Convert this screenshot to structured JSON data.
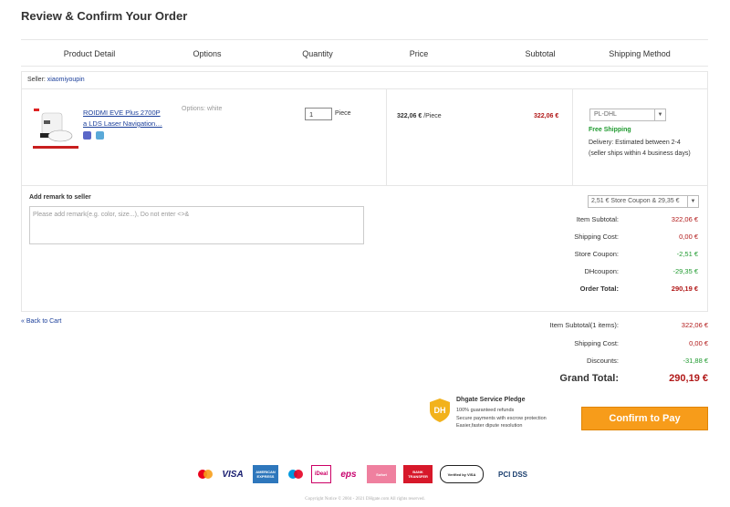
{
  "page_title": "Review & Confirm Your Order",
  "columns": [
    "Product Detail",
    "Options",
    "Quantity",
    "Price",
    "Subtotal",
    "Shipping Method"
  ],
  "seller": {
    "label": "Seller:",
    "name": "xiaomiyoupin"
  },
  "product": {
    "title": "ROIDMI EVE Plus 2700P a LDS Laser Navigation…",
    "options": "Options:  white",
    "quantity": "1",
    "unit": "Piece",
    "price": "322,06 €",
    "price_unit": "/Piece",
    "subtotal": "322,06 €",
    "shipping_method": "PL-DHL",
    "free_shipping": "Free Shipping",
    "delivery": "Delivery: Estimated between 2-4 (seller ships within 4 business days)"
  },
  "remark": {
    "label": "Add remark to seller",
    "placeholder": "Please add remark(e.g. color, size...), Do not enter <>&"
  },
  "coupon_select": "2,51 € Store Coupon & 29,35 €",
  "store_totals": [
    {
      "label": "Item Subtotal:",
      "value": "322,06 €",
      "tone": "red"
    },
    {
      "label": "Shipping Cost:",
      "value": "0,00 €",
      "tone": "red"
    },
    {
      "label": "Store Coupon:",
      "value": "-2,51 €",
      "tone": "green"
    },
    {
      "label": "DHcoupon:",
      "value": "-29,35 €",
      "tone": "green"
    },
    {
      "label": "Order Total:",
      "value": "290,19 €",
      "tone": "red"
    }
  ],
  "back_link": "« Back to Cart",
  "grand": {
    "items_label": "Item Subtotal(1 items):",
    "items_value": "322,06 €",
    "shipping_label": "Shipping Cost:",
    "shipping_value": "0,00 €",
    "discounts_label": "Discounts:",
    "discounts_value": "-31,88 €",
    "total_label": "Grand Total:",
    "total_value": "290,19 €"
  },
  "pledge": {
    "title": "Dhgate Service Pledge",
    "lines": [
      "100% guaranteed refunds",
      "Secure payments with escrow protection",
      "Easier,faster dipute resolution"
    ]
  },
  "confirm_button": "Confirm to Pay",
  "payment_logos": [
    "Mastercard",
    "VISA",
    "AMERICAN EXPRESS",
    "Maestro",
    "iDeal",
    "eps",
    "Sofort",
    "BANK TRANSFER",
    "Verified by VISA",
    "PCI DSS"
  ],
  "copyright": "Copyright Notice © 2004 - 2021 DHgate.com All rights reserved.",
  "colors": {
    "accent_orange": "#f79c1a",
    "price_red": "#b11818",
    "discount_green": "#1f9a2f",
    "link_blue": "#1a3e9a"
  }
}
